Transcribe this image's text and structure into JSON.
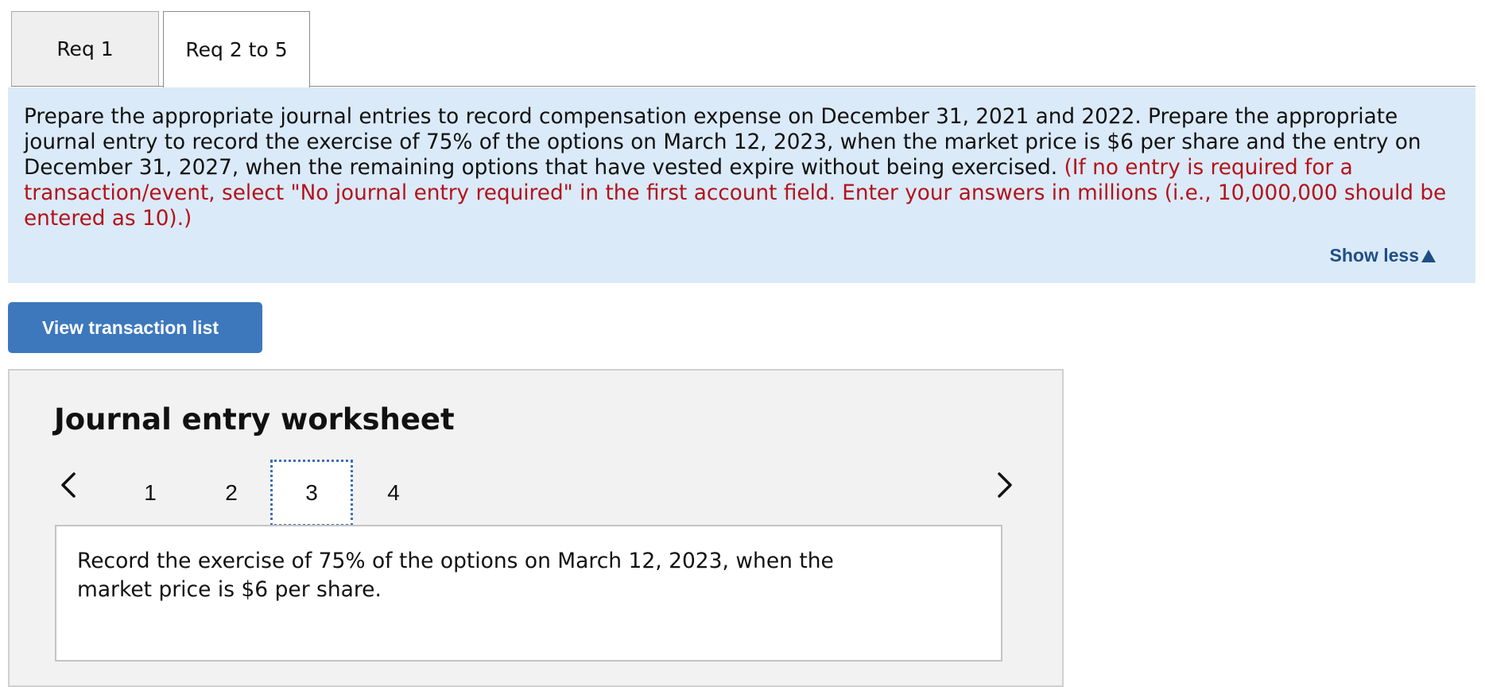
{
  "tabs": [
    {
      "label": "Req 1",
      "active": false
    },
    {
      "label": "Req 2 to 5",
      "active": true
    }
  ],
  "instructions": {
    "text": "Prepare the appropriate journal entries to record compensation expense on December 31, 2021 and 2022. Prepare the appropriate journal entry to record the exercise of 75% of the options on March 12, 2023, when the market price is $6 per share and the entry on December 31, 2027, when the remaining options that have vested expire without being exercised.",
    "note": "(If no entry is required for a transaction/event, select \"No journal entry required\" in the first account field. Enter your answers in millions (i.e., 10,000,000 should be entered as 10).)",
    "show_less_label": "Show less"
  },
  "view_transaction_list_label": "View transaction list",
  "worksheet": {
    "title": "Journal entry worksheet",
    "steps": [
      "1",
      "2",
      "3",
      "4"
    ],
    "active_step": "3",
    "entry_description": "Record the exercise of 75% of the options on March 12, 2023, when the market price is $6 per share."
  },
  "colors": {
    "instructions_bg": "#dbeaf8",
    "note_red": "#b3131a",
    "link_blue": "#1f4e87",
    "button_blue": "#3d78bd"
  }
}
